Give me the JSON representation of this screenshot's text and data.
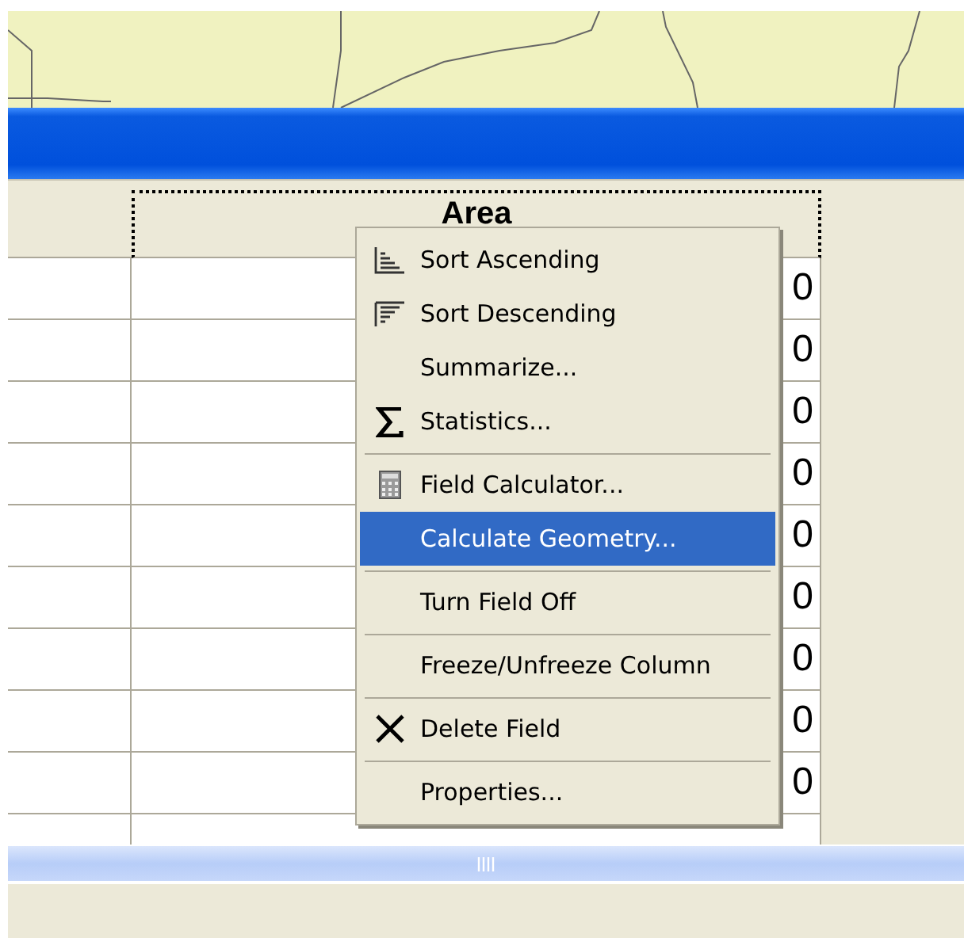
{
  "table": {
    "columns": [
      {
        "selected": false
      },
      {
        "label": "Area",
        "selected": true
      }
    ],
    "rows": [
      {
        "area": "0"
      },
      {
        "area": "0"
      },
      {
        "area": "0"
      },
      {
        "area": "0"
      },
      {
        "area": "0"
      },
      {
        "area": "0"
      },
      {
        "area": "0"
      },
      {
        "area": "0"
      },
      {
        "area": "0"
      },
      {}
    ]
  },
  "context_menu": {
    "groups": [
      [
        {
          "label": "Sort Ascending",
          "selected": false
        },
        {
          "label": "Sort Descending",
          "selected": false
        },
        {
          "label": "Summarize...",
          "selected": false
        },
        {
          "label": "Statistics...",
          "selected": false
        }
      ],
      [
        {
          "label": "Field Calculator...",
          "selected": false
        },
        {
          "label": "Calculate Geometry...",
          "selected": true
        }
      ],
      [
        {
          "label": "Turn Field Off",
          "selected": false
        }
      ],
      [
        {
          "label": "Freeze/Unfreeze Column",
          "selected": false
        }
      ],
      [
        {
          "label": "Delete Field",
          "selected": false
        }
      ],
      [
        {
          "label": "Properties...",
          "selected": false
        }
      ]
    ]
  }
}
